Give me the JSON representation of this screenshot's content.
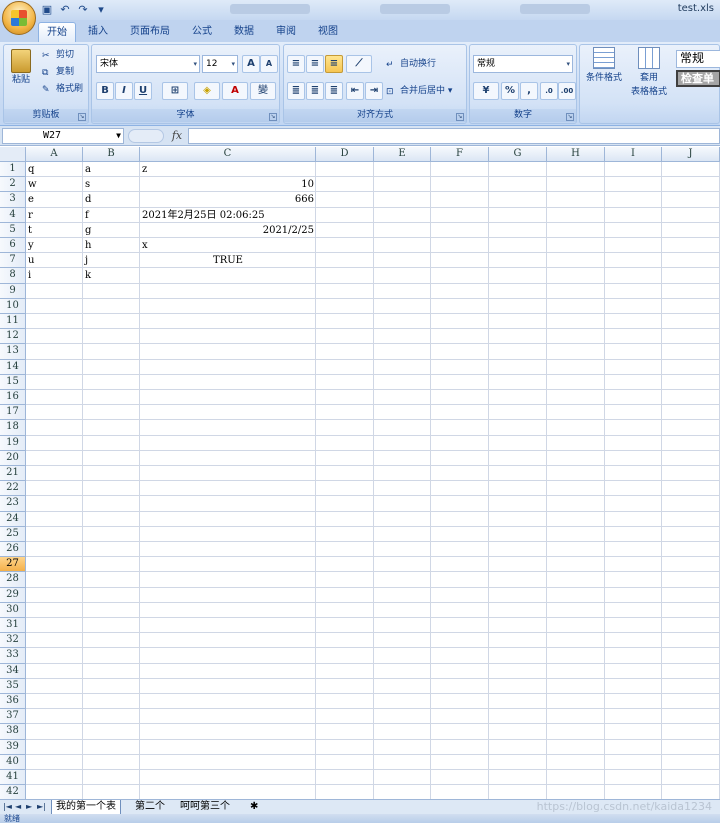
{
  "window": {
    "doc_title": "test.xls"
  },
  "tabs": [
    "开始",
    "插入",
    "页面布局",
    "公式",
    "数据",
    "审阅",
    "视图"
  ],
  "ribbon": {
    "clipboard": {
      "label": "剪贴板",
      "paste": "粘贴",
      "cut": "剪切",
      "copy": "复制",
      "format_painter": "格式刷"
    },
    "font": {
      "label": "字体",
      "family": "宋体",
      "size": "12",
      "bold": "B",
      "italic": "I",
      "underline": "U",
      "grow": "A",
      "shrink": "A",
      "phonetic": "變"
    },
    "alignment": {
      "label": "对齐方式",
      "wrap": "自动换行",
      "merge": "合并后居中"
    },
    "number": {
      "label": "数字",
      "format": "常规",
      "percent": "%",
      "comma": ","
    },
    "styles": {
      "conditional": "条件格式",
      "table_line1": "套用",
      "table_line2": "表格格式",
      "style_normal": "常规",
      "style_check": "检查单"
    }
  },
  "formula_bar": {
    "name_box": "W27",
    "fx": "fx",
    "value": ""
  },
  "columns": [
    "A",
    "B",
    "C",
    "D",
    "E",
    "F",
    "G",
    "H",
    "I",
    "J"
  ],
  "rows": [
    "1",
    "2",
    "3",
    "4",
    "5",
    "6",
    "7",
    "8",
    "9",
    "10",
    "11",
    "12",
    "13",
    "14",
    "15",
    "16",
    "17",
    "18",
    "19",
    "20",
    "21",
    "22",
    "23",
    "24",
    "25",
    "26",
    "27",
    "28",
    "29",
    "30",
    "31",
    "32",
    "33",
    "34",
    "35",
    "36",
    "37",
    "38",
    "39",
    "40",
    "41",
    "42"
  ],
  "selected_row": "27",
  "cells": [
    {
      "row": 1,
      "col": "A",
      "value": "q",
      "align": "left"
    },
    {
      "row": 1,
      "col": "B",
      "value": "a",
      "align": "left"
    },
    {
      "row": 1,
      "col": "C",
      "value": "z",
      "align": "left"
    },
    {
      "row": 2,
      "col": "A",
      "value": "w",
      "align": "left"
    },
    {
      "row": 2,
      "col": "B",
      "value": "s",
      "align": "left"
    },
    {
      "row": 2,
      "col": "C",
      "value": "10",
      "align": "right"
    },
    {
      "row": 3,
      "col": "A",
      "value": "e",
      "align": "left"
    },
    {
      "row": 3,
      "col": "B",
      "value": "d",
      "align": "left"
    },
    {
      "row": 3,
      "col": "C",
      "value": "666",
      "align": "right"
    },
    {
      "row": 4,
      "col": "A",
      "value": "r",
      "align": "left"
    },
    {
      "row": 4,
      "col": "B",
      "value": "f",
      "align": "left"
    },
    {
      "row": 4,
      "col": "C",
      "value": "2021年2月25日  02:06:25",
      "align": "left"
    },
    {
      "row": 5,
      "col": "A",
      "value": "t",
      "align": "left"
    },
    {
      "row": 5,
      "col": "B",
      "value": "g",
      "align": "left"
    },
    {
      "row": 5,
      "col": "C",
      "value": "2021/2/25",
      "align": "right"
    },
    {
      "row": 6,
      "col": "A",
      "value": "y",
      "align": "left"
    },
    {
      "row": 6,
      "col": "B",
      "value": "h",
      "align": "left"
    },
    {
      "row": 6,
      "col": "C",
      "value": "x",
      "align": "left"
    },
    {
      "row": 7,
      "col": "A",
      "value": "u",
      "align": "left"
    },
    {
      "row": 7,
      "col": "B",
      "value": "j",
      "align": "left"
    },
    {
      "row": 7,
      "col": "C",
      "value": "TRUE",
      "align": "center"
    },
    {
      "row": 8,
      "col": "A",
      "value": "i",
      "align": "left"
    },
    {
      "row": 8,
      "col": "B",
      "value": "k",
      "align": "left"
    }
  ],
  "sheets": [
    "我的第一个表",
    "第二个",
    "呵呵第三个"
  ],
  "active_sheet": "我的第一个表",
  "watermark": "https://blog.csdn.net/kaida1234",
  "status": "就绪"
}
